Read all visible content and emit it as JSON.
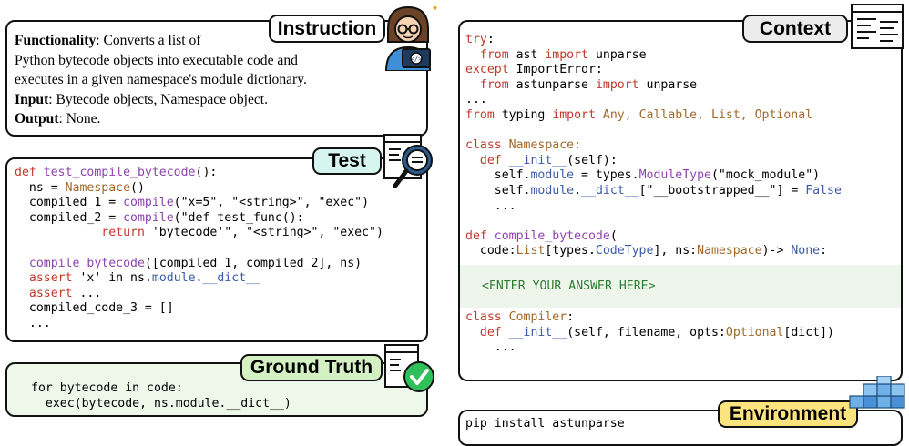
{
  "instruction": {
    "title": "Instruction",
    "lines": [
      {
        "label": "Functionality",
        "text": ": Converts a list of"
      },
      {
        "label": "",
        "text": "Python bytecode objects into executable code and"
      },
      {
        "label": "",
        "text": "executes in a given namespace's module dictionary."
      },
      {
        "label": "Input",
        "text": ": Bytecode objects, Namespace object."
      },
      {
        "label": "Output",
        "text": ": None."
      }
    ]
  },
  "test": {
    "title": "Test",
    "code": [
      [
        {
          "t": "def ",
          "c": "kw"
        },
        {
          "t": "test_compile_bytecode",
          "c": "fn"
        },
        {
          "t": "():",
          "c": ""
        }
      ],
      [
        {
          "t": "  ns = ",
          "c": ""
        },
        {
          "t": "Namespace",
          "c": "ty"
        },
        {
          "t": "()",
          "c": ""
        }
      ],
      [
        {
          "t": "  compiled_1 = ",
          "c": ""
        },
        {
          "t": "compile",
          "c": "fn"
        },
        {
          "t": "(\"x=5\", \"<string>\", \"exec\")",
          "c": ""
        }
      ],
      [
        {
          "t": "  compiled_2 = ",
          "c": ""
        },
        {
          "t": "compile",
          "c": "fn"
        },
        {
          "t": "(\"def test_func():",
          "c": ""
        }
      ],
      [
        {
          "t": "            ",
          "c": ""
        },
        {
          "t": "return",
          "c": "kw"
        },
        {
          "t": " 'bytecode'\", \"<string>\", \"exec\")",
          "c": ""
        }
      ],
      [],
      [
        {
          "t": "  ",
          "c": ""
        },
        {
          "t": "compile_bytecode",
          "c": "fn"
        },
        {
          "t": "([compiled_1, compiled_2], ns)",
          "c": ""
        }
      ],
      [
        {
          "t": "  ",
          "c": ""
        },
        {
          "t": "assert",
          "c": "kw"
        },
        {
          "t": " 'x' in ns.",
          "c": ""
        },
        {
          "t": "module",
          "c": "at"
        },
        {
          "t": ".",
          "c": ""
        },
        {
          "t": "__dict__",
          "c": "at"
        }
      ],
      [
        {
          "t": "  ",
          "c": ""
        },
        {
          "t": "assert",
          "c": "kw"
        },
        {
          "t": " ...",
          "c": ""
        }
      ],
      [
        {
          "t": "  compiled_code_3 = []",
          "c": ""
        }
      ],
      [
        {
          "t": "  ...",
          "c": ""
        }
      ]
    ]
  },
  "ground_truth": {
    "title": "Ground Truth",
    "code": [
      [
        {
          "t": "for bytecode in code:",
          "c": ""
        }
      ],
      [
        {
          "t": "  exec(bytecode, ns.module.__dict__)",
          "c": ""
        }
      ]
    ]
  },
  "context": {
    "title": "Context",
    "code": [
      [
        {
          "t": "try",
          "c": "kw"
        },
        {
          "t": ":",
          "c": ""
        }
      ],
      [
        {
          "t": "  ",
          "c": ""
        },
        {
          "t": "from",
          "c": "kw"
        },
        {
          "t": " ast ",
          "c": ""
        },
        {
          "t": "import",
          "c": "kw"
        },
        {
          "t": " unparse",
          "c": ""
        }
      ],
      [
        {
          "t": "except",
          "c": "kw"
        },
        {
          "t": " ImportError:",
          "c": ""
        }
      ],
      [
        {
          "t": "  ",
          "c": ""
        },
        {
          "t": "from",
          "c": "kw"
        },
        {
          "t": " astunparse ",
          "c": ""
        },
        {
          "t": "import",
          "c": "kw"
        },
        {
          "t": " unparse",
          "c": ""
        }
      ],
      [
        {
          "t": "...",
          "c": ""
        }
      ],
      [
        {
          "t": "from",
          "c": "kw"
        },
        {
          "t": " typing ",
          "c": ""
        },
        {
          "t": "import",
          "c": "kw"
        },
        {
          "t": " Any, Callable, List, Optional",
          "c": "ty"
        }
      ],
      [],
      [
        {
          "t": "class",
          "c": "kw"
        },
        {
          "t": " Namespace:",
          "c": "ty"
        }
      ],
      [
        {
          "t": "  ",
          "c": ""
        },
        {
          "t": "def",
          "c": "kw"
        },
        {
          "t": " ",
          "c": ""
        },
        {
          "t": "__init__",
          "c": "at"
        },
        {
          "t": "(self):",
          "c": ""
        }
      ],
      [
        {
          "t": "    self.",
          "c": ""
        },
        {
          "t": "module",
          "c": "at"
        },
        {
          "t": " = types.",
          "c": ""
        },
        {
          "t": "ModuleType",
          "c": "fn"
        },
        {
          "t": "(\"mock_module\")",
          "c": ""
        }
      ],
      [
        {
          "t": "    self.",
          "c": ""
        },
        {
          "t": "module",
          "c": "at"
        },
        {
          "t": ".",
          "c": ""
        },
        {
          "t": "__dict__",
          "c": "at"
        },
        {
          "t": "[\"__bootstrapped__\"] = ",
          "c": ""
        },
        {
          "t": "False",
          "c": "at"
        }
      ],
      [
        {
          "t": "    ...",
          "c": ""
        }
      ],
      [],
      [
        {
          "t": "def",
          "c": "kw"
        },
        {
          "t": " ",
          "c": ""
        },
        {
          "t": "compile_bytecode",
          "c": "fn"
        },
        {
          "t": "(",
          "c": ""
        }
      ],
      [
        {
          "t": "  code:",
          "c": ""
        },
        {
          "t": "List",
          "c": "ty"
        },
        {
          "t": "[types.",
          "c": ""
        },
        {
          "t": "CodeType",
          "c": "at"
        },
        {
          "t": "], ns:",
          "c": ""
        },
        {
          "t": "Namespace",
          "c": "ty"
        },
        {
          "t": ")-> ",
          "c": ""
        },
        {
          "t": "None",
          "c": "at"
        },
        {
          "t": ":",
          "c": ""
        }
      ]
    ],
    "placeholder": "<ENTER YOUR ANSWER HERE>",
    "code_after": [
      [
        {
          "t": "class",
          "c": "kw"
        },
        {
          "t": " ",
          "c": ""
        },
        {
          "t": "Compiler",
          "c": "ty"
        },
        {
          "t": ":",
          "c": ""
        }
      ],
      [
        {
          "t": "  ",
          "c": ""
        },
        {
          "t": "def",
          "c": "kw"
        },
        {
          "t": " ",
          "c": ""
        },
        {
          "t": "__init__",
          "c": "at"
        },
        {
          "t": "(self, filename, opts:",
          "c": ""
        },
        {
          "t": "Optional",
          "c": "ty"
        },
        {
          "t": "[dict])",
          "c": ""
        }
      ],
      [
        {
          "t": "    ...",
          "c": ""
        }
      ]
    ]
  },
  "environment": {
    "title": "Environment",
    "command": "pip install astunparse"
  },
  "colors": {
    "tab_instruction": "#ffffff",
    "tab_test": "#d6f5ee",
    "tab_ground_truth": "#d4f1c4",
    "tab_context": "#ececec",
    "tab_environment": "#fbe37d",
    "test_bg": "#ffffff",
    "ground_truth_bg": "#eef8ea",
    "placeholder_bg": "#eef6ec",
    "placeholder_text": "#2e7d32"
  }
}
